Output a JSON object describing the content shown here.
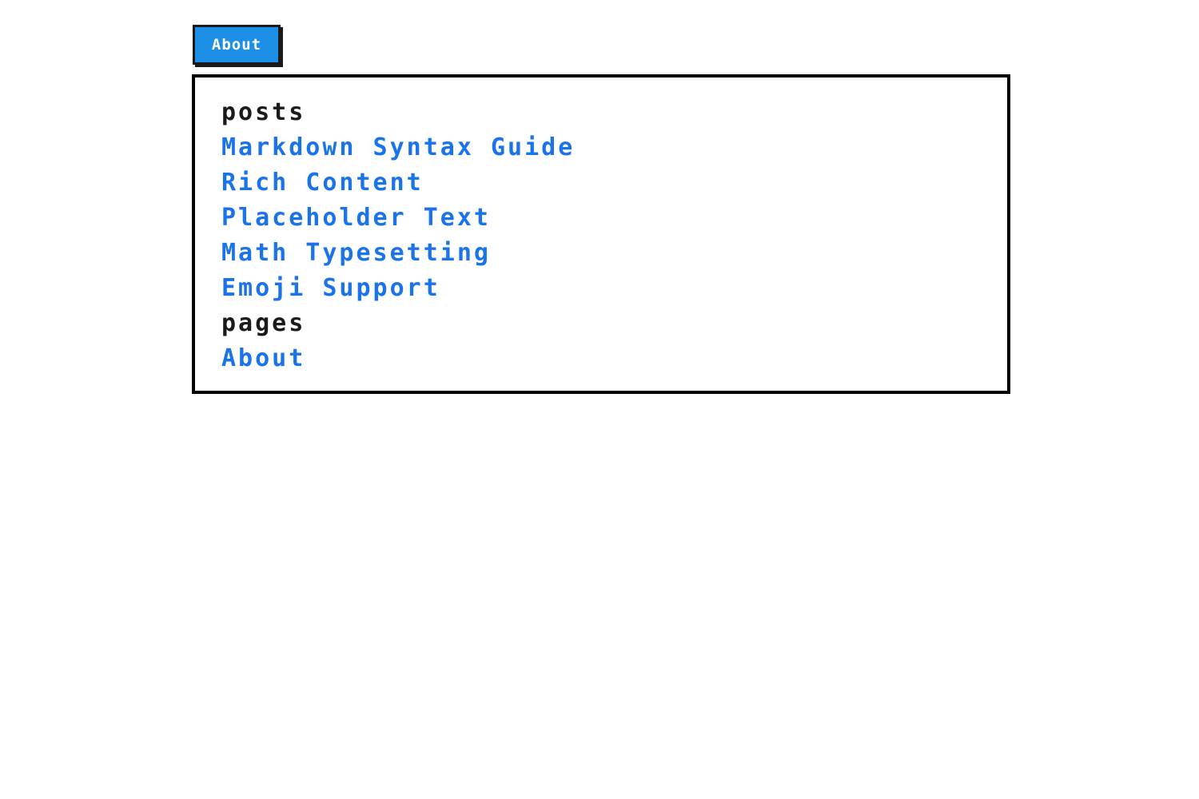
{
  "header": {
    "about_button_label": "About"
  },
  "menu": {
    "posts_heading": "posts",
    "posts": [
      {
        "label": "Markdown Syntax Guide"
      },
      {
        "label": "Rich Content"
      },
      {
        "label": "Placeholder Text"
      },
      {
        "label": "Math Typesetting"
      },
      {
        "label": "Emoji Support"
      }
    ],
    "pages_heading": "pages",
    "pages": [
      {
        "label": "About"
      }
    ]
  },
  "colors": {
    "button_bg": "#1d8fe6",
    "link": "#1a73e8",
    "border": "#000000",
    "heading": "#1a1a1a"
  }
}
